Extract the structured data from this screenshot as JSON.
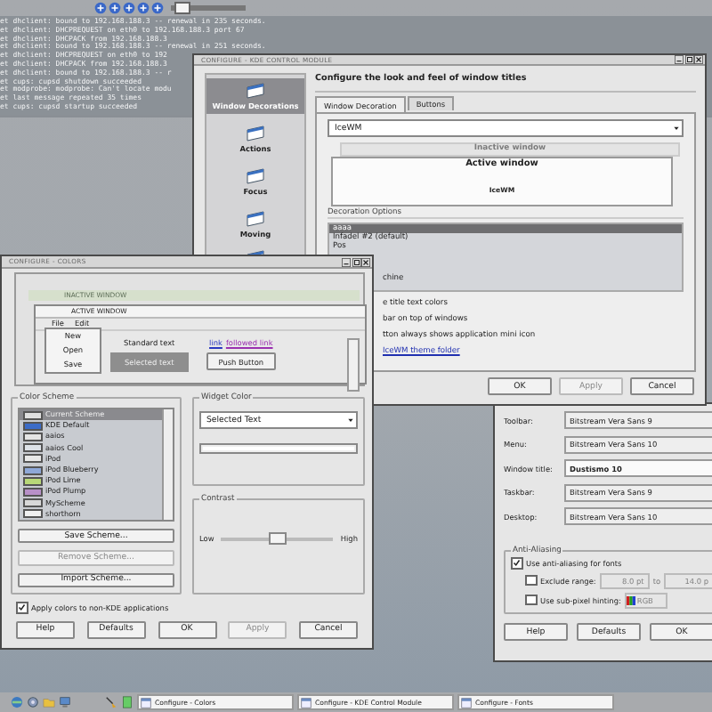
{
  "top_bar": {
    "slider": {
      "level": 0.05
    }
  },
  "log_lines": [
    "et dhclient: bound to 192.168.188.3 -- renewal in 235 seconds.",
    "et dhclient: DHCPREQUEST on eth0 to 192.168.188.3 port 67",
    "et dhclient: DHCPACK from 192.168.188.3",
    "et dhclient: bound to 192.168.188.3 -- renewal in 251 seconds.",
    "et dhclient: DHCPREQUEST on eth0 to 192",
    "et dhclient: DHCPACK from 192.168.188.3",
    "et dhclient: bound to 192.168.188.3 -- r",
    "et cups: cupsd shutdown succeeded",
    "et modprobe: modprobe: Can't locate modu",
    "et last message repeated 35 times",
    "et cups: cupsd startup succeeded"
  ],
  "control_module": {
    "title": "CONFIGURE - KDE CONTROL MODULE",
    "sidebar": [
      {
        "label": "Window Decorations",
        "selected": true
      },
      {
        "label": "Actions",
        "selected": false
      },
      {
        "label": "Focus",
        "selected": false
      },
      {
        "label": "Moving",
        "selected": false
      }
    ],
    "heading": "Configure the look and feel of window titles",
    "tabs": [
      {
        "label": "Window Decoration",
        "selected": true
      },
      {
        "label": "Buttons",
        "selected": false
      }
    ],
    "style_select": "IceWM",
    "preview": {
      "inactive_title": "Inactive window",
      "active_title": "Active window",
      "body": "IceWM"
    },
    "options_heading": "Decoration Options",
    "options": [
      {
        "label": "aaaa",
        "selected": true
      },
      {
        "label": "Infadel #2 (default)",
        "selected": false
      },
      {
        "label": "Pos",
        "selected": false
      },
      {
        "label": "chine",
        "selected": false
      }
    ],
    "option_texts": [
      "e title text colors",
      "bar on top of windows",
      "tton always shows application mini icon"
    ],
    "link": "IceWM theme folder",
    "buttons": [
      {
        "label": "OK",
        "disabled": false
      },
      {
        "label": "Apply",
        "disabled": true
      },
      {
        "label": "Cancel",
        "disabled": false
      }
    ]
  },
  "colors": {
    "title": "CONFIGURE - COLORS",
    "preview": {
      "inactive_title": "INACTIVE WINDOW",
      "active_title": "ACTIVE WINDOW",
      "menus": [
        "File",
        "Edit"
      ],
      "menu_items": [
        "New",
        "Open",
        "Save"
      ],
      "standard_text": "Standard text",
      "selected_text": "Selected text",
      "link": "link",
      "followed_link": "followed link",
      "push_button": "Push Button"
    },
    "scheme_heading": "Color Scheme",
    "schemes": [
      {
        "label": "Current Scheme",
        "color": "#e0e0e0",
        "selected": true
      },
      {
        "label": "KDE Default",
        "color": "#3c6cc8",
        "selected": false
      },
      {
        "label": "aaios",
        "color": "#e4e4e4",
        "selected": false
      },
      {
        "label": "aaios Cool",
        "color": "#dde2e8",
        "selected": false
      },
      {
        "label": "iPod",
        "color": "#e8e8e8",
        "selected": false
      },
      {
        "label": "iPod Blueberry",
        "color": "#8ea8d8",
        "selected": false
      },
      {
        "label": "iPod Lime",
        "color": "#b8d878",
        "selected": false
      },
      {
        "label": "iPod Plump",
        "color": "#b890c8",
        "selected": false
      },
      {
        "label": "MyScheme",
        "color": "#d8d8d8",
        "selected": false
      },
      {
        "label": "shorthorn",
        "color": "#f0f0f0",
        "selected": false
      }
    ],
    "scheme_buttons": [
      {
        "label": "Save Scheme...",
        "disabled": false
      },
      {
        "label": "Remove Scheme...",
        "disabled": true
      },
      {
        "label": "Import Scheme...",
        "disabled": false
      }
    ],
    "widget_heading": "Widget Color",
    "widget_select": "Selected Text",
    "contrast_heading": "Contrast",
    "contrast": {
      "low": "Low",
      "high": "High",
      "level": 0.5
    },
    "apply_non_kde": {
      "label": "Apply colors to non-KDE applications",
      "checked": true
    },
    "buttons": [
      {
        "label": "Help",
        "disabled": false
      },
      {
        "label": "Defaults",
        "disabled": false
      },
      {
        "label": "OK",
        "disabled": false
      },
      {
        "label": "Apply",
        "disabled": true
      },
      {
        "label": "Cancel",
        "disabled": false
      }
    ]
  },
  "fonts": {
    "rows": [
      {
        "label": "Toolbar:",
        "value": "Bitstream Vera Sans 9"
      },
      {
        "label": "Menu:",
        "value": "Bitstream Vera Sans 10"
      },
      {
        "label": "Window title:",
        "value": "Dustismo 10"
      },
      {
        "label": "Taskbar:",
        "value": "Bitstream Vera Sans 9"
      },
      {
        "label": "Desktop:",
        "value": "Bitstream Vera Sans 10"
      }
    ],
    "aa_heading": "Anti-Aliasing",
    "aa_checks": [
      {
        "kind": "plain",
        "label": "Use anti-aliasing for fonts",
        "checked": true
      },
      {
        "kind": "range",
        "label": "Exclude range:",
        "checked": false,
        "from": "8.0 pt",
        "to_label": "to",
        "to": "14.0 p"
      },
      {
        "kind": "select",
        "label": "Use sub-pixel hinting:",
        "checked": false,
        "value": "RGB"
      }
    ],
    "buttons": [
      "Help",
      "Defaults",
      "OK"
    ]
  },
  "taskbar": {
    "tasks": [
      "Configure - Colors",
      "Configure - KDE Control Module",
      "Configure - Fonts"
    ]
  }
}
